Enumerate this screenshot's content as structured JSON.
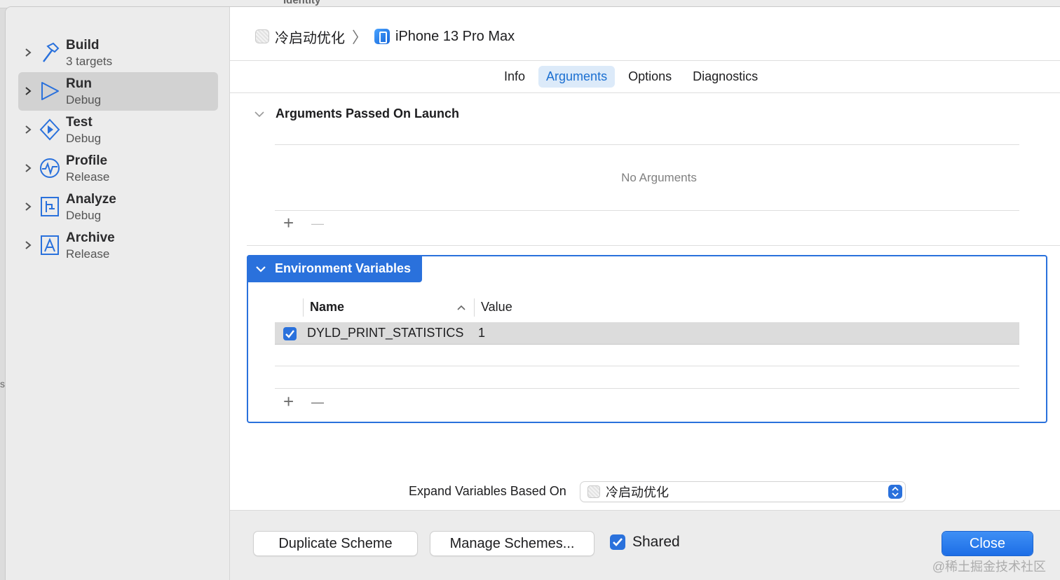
{
  "background": {
    "ghost_title": "Identity"
  },
  "sidebar": {
    "actions": [
      {
        "name": "Build",
        "sub": "3 targets",
        "icon": "hammer-icon"
      },
      {
        "name": "Run",
        "sub": "Debug",
        "icon": "play-icon",
        "selected": true
      },
      {
        "name": "Test",
        "sub": "Debug",
        "icon": "test-diamond-icon"
      },
      {
        "name": "Profile",
        "sub": "Release",
        "icon": "waveform-icon"
      },
      {
        "name": "Analyze",
        "sub": "Debug",
        "icon": "analyze-icon"
      },
      {
        "name": "Archive",
        "sub": "Release",
        "icon": "archive-icon"
      }
    ]
  },
  "header": {
    "scheme": "冷启动优化",
    "separator": "〉",
    "destination": "iPhone 13 Pro Max"
  },
  "tabs": [
    "Info",
    "Arguments",
    "Options",
    "Diagnostics"
  ],
  "active_tab": "Arguments",
  "arguments_section": {
    "title": "Arguments Passed On Launch",
    "empty_text": "No Arguments",
    "add": "+",
    "remove": "—"
  },
  "env_section": {
    "title": "Environment Variables",
    "columns": {
      "name": "Name",
      "value": "Value",
      "sort_indicator": "^"
    },
    "rows": [
      {
        "enabled": true,
        "name": "DYLD_PRINT_STATISTICS",
        "value": "1"
      }
    ],
    "add": "+",
    "remove": "—"
  },
  "expand_variables": {
    "label": "Expand Variables Based On",
    "selected": "冷启动优化"
  },
  "footer": {
    "duplicate": "Duplicate Scheme",
    "manage": "Manage Schemes...",
    "shared_label": "Shared",
    "shared_checked": true,
    "close": "Close",
    "watermark": "@稀土掘金技术社区"
  },
  "colors": {
    "accent": "#2a71dc",
    "sidebar_bg": "#ececec",
    "selected_row": "#d2d2d2"
  }
}
